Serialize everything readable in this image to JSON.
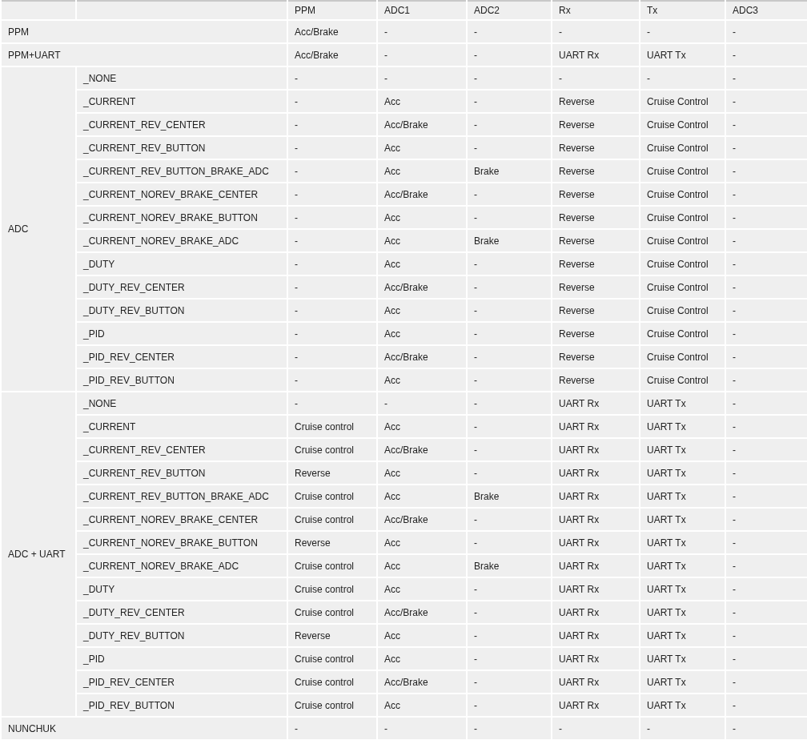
{
  "table": {
    "columns": [
      "PPM",
      "ADC1",
      "ADC2",
      "Rx",
      "Tx",
      "ADC3"
    ],
    "groups": [
      {
        "label": "PPM",
        "rows": [
          {
            "cells": [
              "Acc/Brake",
              "-",
              "-",
              "-",
              "-",
              "-"
            ]
          }
        ]
      },
      {
        "label": "PPM+UART",
        "rows": [
          {
            "cells": [
              "Acc/Brake",
              "-",
              "-",
              "UART Rx",
              "UART Tx",
              "-"
            ]
          }
        ]
      },
      {
        "label": "ADC",
        "rows": [
          {
            "variant": "_NONE",
            "cells": [
              "-",
              "-",
              "-",
              "-",
              "-",
              "-"
            ]
          },
          {
            "variant": "_CURRENT",
            "cells": [
              "-",
              "Acc",
              "-",
              "Reverse",
              "Cruise Control",
              "-"
            ]
          },
          {
            "variant": "_CURRENT_REV_CENTER",
            "cells": [
              "-",
              "Acc/Brake",
              "-",
              "Reverse",
              "Cruise Control",
              "-"
            ]
          },
          {
            "variant": "_CURRENT_REV_BUTTON",
            "cells": [
              "-",
              "Acc",
              "-",
              "Reverse",
              "Cruise Control",
              "-"
            ]
          },
          {
            "variant": "_CURRENT_REV_BUTTON_BRAKE_ADC",
            "cells": [
              "-",
              "Acc",
              "Brake",
              "Reverse",
              "Cruise Control",
              "-"
            ]
          },
          {
            "variant": "_CURRENT_NOREV_BRAKE_CENTER",
            "cells": [
              "-",
              "Acc/Brake",
              "-",
              "Reverse",
              "Cruise Control",
              "-"
            ]
          },
          {
            "variant": "_CURRENT_NOREV_BRAKE_BUTTON",
            "cells": [
              "-",
              "Acc",
              "-",
              "Reverse",
              "Cruise Control",
              "-"
            ]
          },
          {
            "variant": "_CURRENT_NOREV_BRAKE_ADC",
            "cells": [
              "-",
              "Acc",
              "Brake",
              "Reverse",
              "Cruise Control",
              "-"
            ]
          },
          {
            "variant": "_DUTY",
            "cells": [
              "-",
              "Acc",
              "-",
              "Reverse",
              "Cruise Control",
              "-"
            ]
          },
          {
            "variant": "_DUTY_REV_CENTER",
            "cells": [
              "-",
              "Acc/Brake",
              "-",
              "Reverse",
              "Cruise Control",
              "-"
            ]
          },
          {
            "variant": "_DUTY_REV_BUTTON",
            "cells": [
              "-",
              "Acc",
              "-",
              "Reverse",
              "Cruise Control",
              "-"
            ]
          },
          {
            "variant": "_PID",
            "cells": [
              "-",
              "Acc",
              "-",
              "Reverse",
              "Cruise Control",
              "-"
            ]
          },
          {
            "variant": "_PID_REV_CENTER",
            "cells": [
              "-",
              "Acc/Brake",
              "-",
              "Reverse",
              "Cruise Control",
              "-"
            ]
          },
          {
            "variant": "_PID_REV_BUTTON",
            "cells": [
              "-",
              "Acc",
              "-",
              "Reverse",
              "Cruise Control",
              "-"
            ]
          }
        ]
      },
      {
        "label": "ADC + UART",
        "rows": [
          {
            "variant": "_NONE",
            "cells": [
              "-",
              "-",
              "-",
              "UART Rx",
              "UART Tx",
              "-"
            ]
          },
          {
            "variant": "_CURRENT",
            "cells": [
              "Cruise control",
              "Acc",
              "-",
              "UART Rx",
              "UART Tx",
              "-"
            ]
          },
          {
            "variant": "_CURRENT_REV_CENTER",
            "cells": [
              "Cruise control",
              "Acc/Brake",
              "-",
              "UART Rx",
              "UART Tx",
              "-"
            ]
          },
          {
            "variant": "_CURRENT_REV_BUTTON",
            "cells": [
              "Reverse",
              "Acc",
              "-",
              "UART Rx",
              "UART Tx",
              "-"
            ]
          },
          {
            "variant": "_CURRENT_REV_BUTTON_BRAKE_ADC",
            "cells": [
              "Cruise control",
              "Acc",
              "Brake",
              "UART Rx",
              "UART Tx",
              "-"
            ]
          },
          {
            "variant": "_CURRENT_NOREV_BRAKE_CENTER",
            "cells": [
              "Cruise control",
              "Acc/Brake",
              "-",
              "UART Rx",
              "UART Tx",
              "-"
            ]
          },
          {
            "variant": "_CURRENT_NOREV_BRAKE_BUTTON",
            "cells": [
              "Reverse",
              "Acc",
              "-",
              "UART Rx",
              "UART Tx",
              "-"
            ]
          },
          {
            "variant": "_CURRENT_NOREV_BRAKE_ADC",
            "cells": [
              "Cruise control",
              "Acc",
              "Brake",
              "UART Rx",
              "UART Tx",
              "-"
            ]
          },
          {
            "variant": "_DUTY",
            "cells": [
              "Cruise control",
              "Acc",
              "-",
              "UART Rx",
              "UART Tx",
              "-"
            ]
          },
          {
            "variant": "_DUTY_REV_CENTER",
            "cells": [
              "Cruise control",
              "Acc/Brake",
              "-",
              "UART Rx",
              "UART Tx",
              "-"
            ]
          },
          {
            "variant": "_DUTY_REV_BUTTON",
            "cells": [
              "Reverse",
              "Acc",
              "-",
              "UART Rx",
              "UART Tx",
              "-"
            ]
          },
          {
            "variant": "_PID",
            "cells": [
              "Cruise control",
              "Acc",
              "-",
              "UART Rx",
              "UART Tx",
              "-"
            ]
          },
          {
            "variant": "_PID_REV_CENTER",
            "cells": [
              "Cruise control",
              "Acc/Brake",
              "-",
              "UART Rx",
              "UART Tx",
              "-"
            ]
          },
          {
            "variant": "_PID_REV_BUTTON",
            "cells": [
              "Cruise control",
              "Acc",
              "-",
              "UART Rx",
              "UART Tx",
              "-"
            ]
          }
        ]
      },
      {
        "label": "NUNCHUK",
        "rows": [
          {
            "cells": [
              "-",
              "-",
              "-",
              "-",
              "-",
              "-"
            ]
          }
        ]
      }
    ]
  }
}
